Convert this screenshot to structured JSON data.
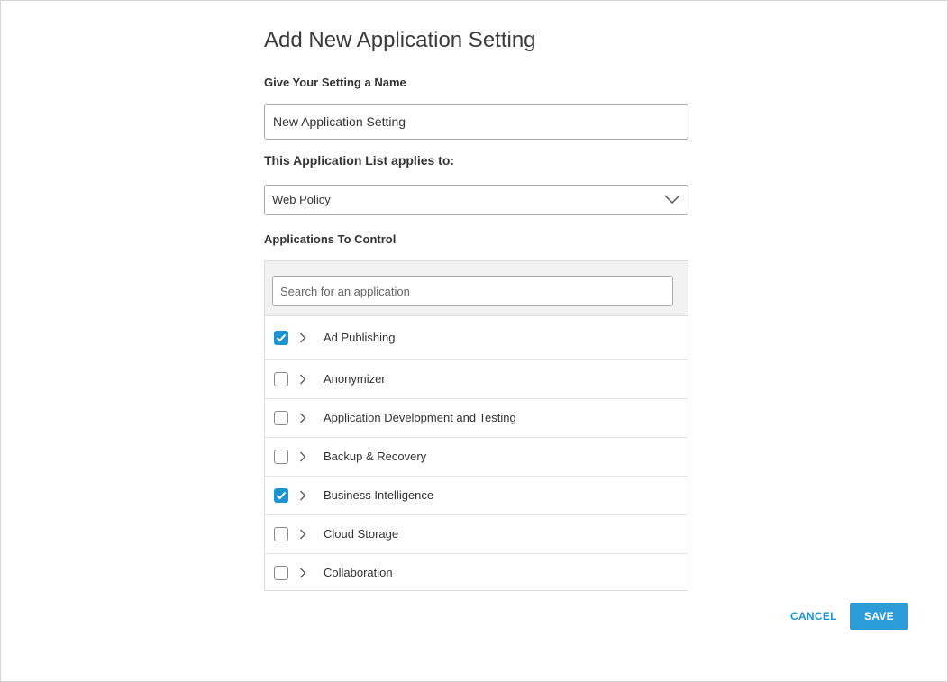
{
  "dialog": {
    "title": "Add New Application Setting",
    "name_label": "Give Your Setting a Name",
    "name_value": "New Application Setting",
    "applies_label": "This Application List applies to:",
    "applies_value": "Web Policy",
    "apps_label": "Applications To Control",
    "search_placeholder": "Search for an application",
    "apps": [
      {
        "label": "Ad Publishing",
        "checked": true
      },
      {
        "label": "Anonymizer",
        "checked": false
      },
      {
        "label": "Application Development and Testing",
        "checked": false
      },
      {
        "label": "Backup & Recovery",
        "checked": false
      },
      {
        "label": "Business Intelligence",
        "checked": true
      },
      {
        "label": "Cloud Storage",
        "checked": false
      },
      {
        "label": "Collaboration",
        "checked": false
      }
    ]
  },
  "actions": {
    "cancel_label": "CANCEL",
    "save_label": "SAVE"
  },
  "colors": {
    "accent": "#1e93d2",
    "save_bg": "#2b9cd8"
  },
  "icons": {
    "select_caret": "chevron-down-icon",
    "row_expand": "chevron-right-icon",
    "checkbox_mark": "checkmark-icon"
  }
}
